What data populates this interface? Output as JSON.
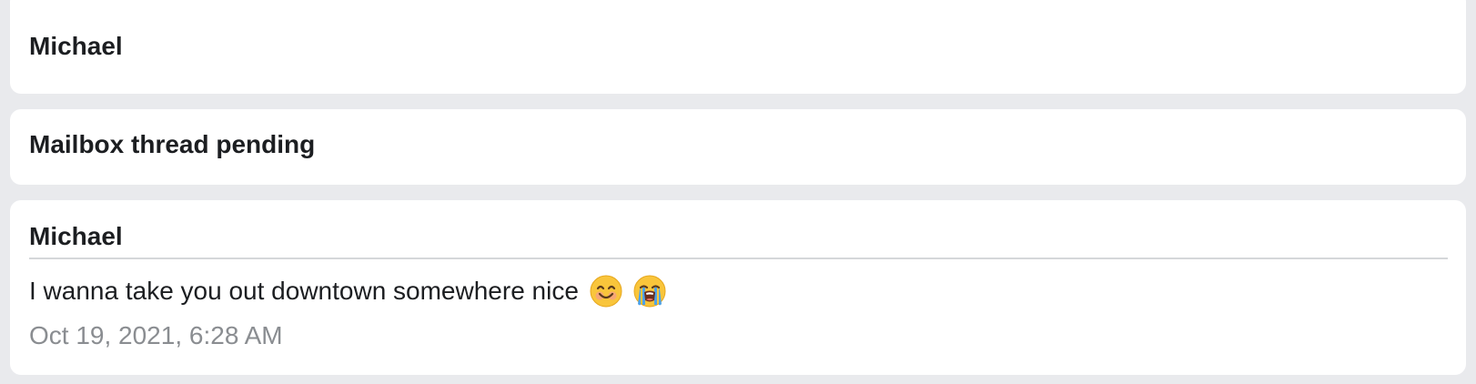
{
  "header_card": {
    "title": "Michael"
  },
  "pending_card": {
    "title": "Mailbox thread pending"
  },
  "message_card": {
    "sender": "Michael",
    "text": "I wanna take you out downtown somewhere nice",
    "emojis": [
      "smiling-face-icon",
      "loudly-crying-face-icon"
    ],
    "timestamp": "Oct 19, 2021, 6:28 AM"
  },
  "colors": {
    "background": "#e9eaed",
    "card": "#ffffff",
    "text": "#1c1e21",
    "muted": "#8a8d91",
    "divider": "#d5d7da"
  }
}
